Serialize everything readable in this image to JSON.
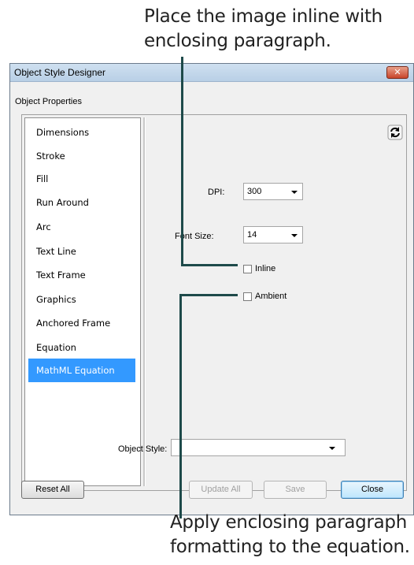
{
  "callouts": {
    "top": "Place the image inline with enclosing paragraph.",
    "bottom": "Apply enclosing paragraph formatting to the equation."
  },
  "window": {
    "title": "Object Style Designer",
    "close_glyph": "✕"
  },
  "properties_label": "Object Properties",
  "categories": [
    {
      "label": "Dimensions",
      "selected": false
    },
    {
      "label": "Stroke",
      "selected": false
    },
    {
      "label": "Fill",
      "selected": false
    },
    {
      "label": "Run Around",
      "selected": false
    },
    {
      "label": "Arc",
      "selected": false
    },
    {
      "label": "Text Line",
      "selected": false
    },
    {
      "label": "Text Frame",
      "selected": false
    },
    {
      "label": "Graphics",
      "selected": false
    },
    {
      "label": "Anchored Frame",
      "selected": false
    },
    {
      "label": "Equation",
      "selected": false
    },
    {
      "label": "MathML Equation",
      "selected": true
    }
  ],
  "fields": {
    "dpi": {
      "label": "DPI:",
      "value": "300"
    },
    "font_size": {
      "label": "Font Size:",
      "value": "14"
    },
    "inline": {
      "label": "Inline",
      "checked": false
    },
    "ambient": {
      "label": "Ambient",
      "checked": false
    }
  },
  "object_style": {
    "label": "Object Style:",
    "value": ""
  },
  "buttons": {
    "reset_all": "Reset All",
    "update_all": "Update All",
    "save": "Save",
    "close": "Close"
  },
  "icons": {
    "refresh": "refresh-icon"
  },
  "colors": {
    "selection": "#3399ff",
    "leader_line": "#1e4a4a",
    "close_button": "#c9452b"
  }
}
